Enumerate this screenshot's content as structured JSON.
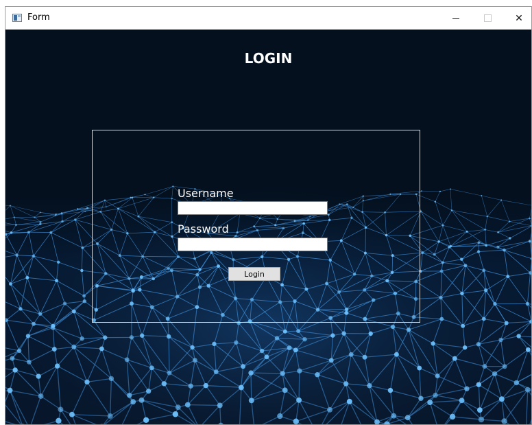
{
  "window": {
    "title": "Form",
    "icons": {
      "app": "app-form-icon",
      "minimize": "minimize-icon",
      "maximize": "maximize-icon",
      "close": "close-icon"
    },
    "close_glyph": "✕"
  },
  "form": {
    "heading": "LOGIN",
    "username_label": "Username",
    "username_value": "",
    "password_label": "Password",
    "password_value": "",
    "login_button": "Login"
  },
  "colors": {
    "background_dark": "#04101e",
    "network_blue": "#3f8ed8",
    "node_glow": "#6fc3ff",
    "text": "#ffffff"
  }
}
